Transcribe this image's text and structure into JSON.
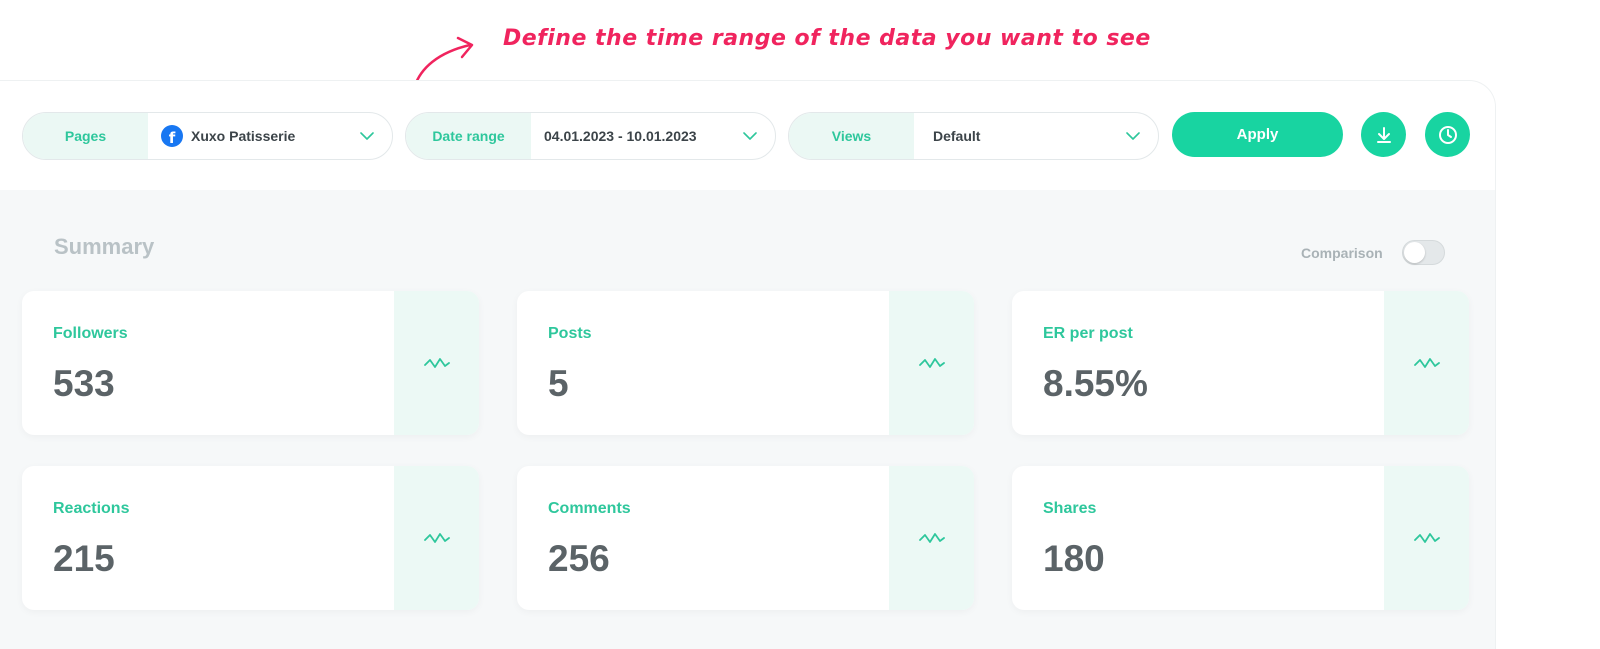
{
  "annotation": {
    "text": "Define the time range of the data you want to see",
    "color": "#f0245e"
  },
  "toolbar": {
    "pages": {
      "label": "Pages",
      "value": "Xuxo Patisserie",
      "icon": "facebook-icon"
    },
    "date_range": {
      "label": "Date range",
      "value": "04.01.2023 - 10.01.2023"
    },
    "views": {
      "label": "Views",
      "value": "Default"
    },
    "apply_label": "Apply",
    "download_icon": "download-icon",
    "history_icon": "clock-icon"
  },
  "summary": {
    "title": "Summary",
    "comparison_label": "Comparison",
    "comparison_enabled": false
  },
  "cards": [
    {
      "label": "Followers",
      "value": "533",
      "icon": "trend-icon"
    },
    {
      "label": "Posts",
      "value": "5",
      "icon": "trend-icon"
    },
    {
      "label": "ER per post",
      "value": "8.55%",
      "icon": "trend-icon"
    },
    {
      "label": "Reactions",
      "value": "215",
      "icon": "trend-icon"
    },
    {
      "label": "Comments",
      "value": "256",
      "icon": "trend-icon"
    },
    {
      "label": "Shares",
      "value": "180",
      "icon": "trend-icon"
    }
  ],
  "colors": {
    "accent": "#18d4a1",
    "accent_text": "#2ec79c",
    "accent_soft": "#ebf8f4",
    "annotation": "#f0245e"
  }
}
